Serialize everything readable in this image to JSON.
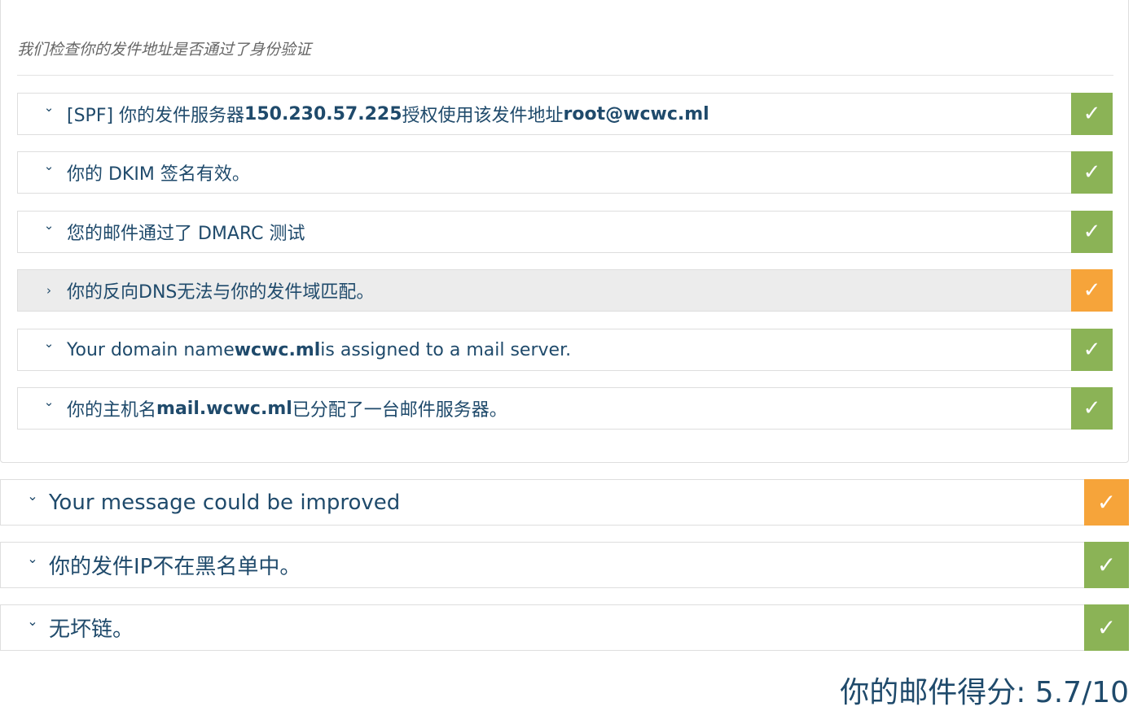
{
  "auth_section": {
    "intro": "我们检查你的发件地址是否通过了身份验证",
    "checks": [
      {
        "expanded": true,
        "status": "pass",
        "parts": [
          {
            "t": "[SPF] 你的发件服务器 ",
            "b": false
          },
          {
            "t": "150.230.57.225",
            "b": true
          },
          {
            "t": " 授权使用该发件地址 ",
            "b": false
          },
          {
            "t": "root@wcwc.ml",
            "b": true
          }
        ]
      },
      {
        "expanded": true,
        "status": "pass",
        "parts": [
          {
            "t": "你的 DKIM 签名有效。",
            "b": false
          }
        ]
      },
      {
        "expanded": true,
        "status": "pass",
        "parts": [
          {
            "t": "您的邮件通过了 DMARC 测试",
            "b": false
          }
        ]
      },
      {
        "expanded": false,
        "status": "warn",
        "parts": [
          {
            "t": "你的反向DNS无法与你的发件域匹配。",
            "b": false
          }
        ]
      },
      {
        "expanded": true,
        "status": "pass",
        "parts": [
          {
            "t": "Your domain name ",
            "b": false
          },
          {
            "t": "wcwc.ml",
            "b": true
          },
          {
            "t": " is assigned to a mail server.",
            "b": false
          }
        ]
      },
      {
        "expanded": true,
        "status": "pass",
        "parts": [
          {
            "t": "你的主机名",
            "b": false
          },
          {
            "t": "mail.wcwc.ml",
            "b": true
          },
          {
            "t": "已分配了一台邮件服务器。",
            "b": false
          }
        ]
      }
    ]
  },
  "sections": [
    {
      "label": "Your message could be improved",
      "status": "warn"
    },
    {
      "label": "你的发件IP不在黑名单中。",
      "status": "pass"
    },
    {
      "label": "无坏链。",
      "status": "pass"
    }
  ],
  "score_label": "你的邮件得分: 5.7/10",
  "icons": {
    "check": "✓",
    "chevron_down": "⌄",
    "chevron_right": "›"
  },
  "colors": {
    "pass": "#8bb356",
    "warn": "#f6a43a",
    "text": "#1f4a6b"
  }
}
